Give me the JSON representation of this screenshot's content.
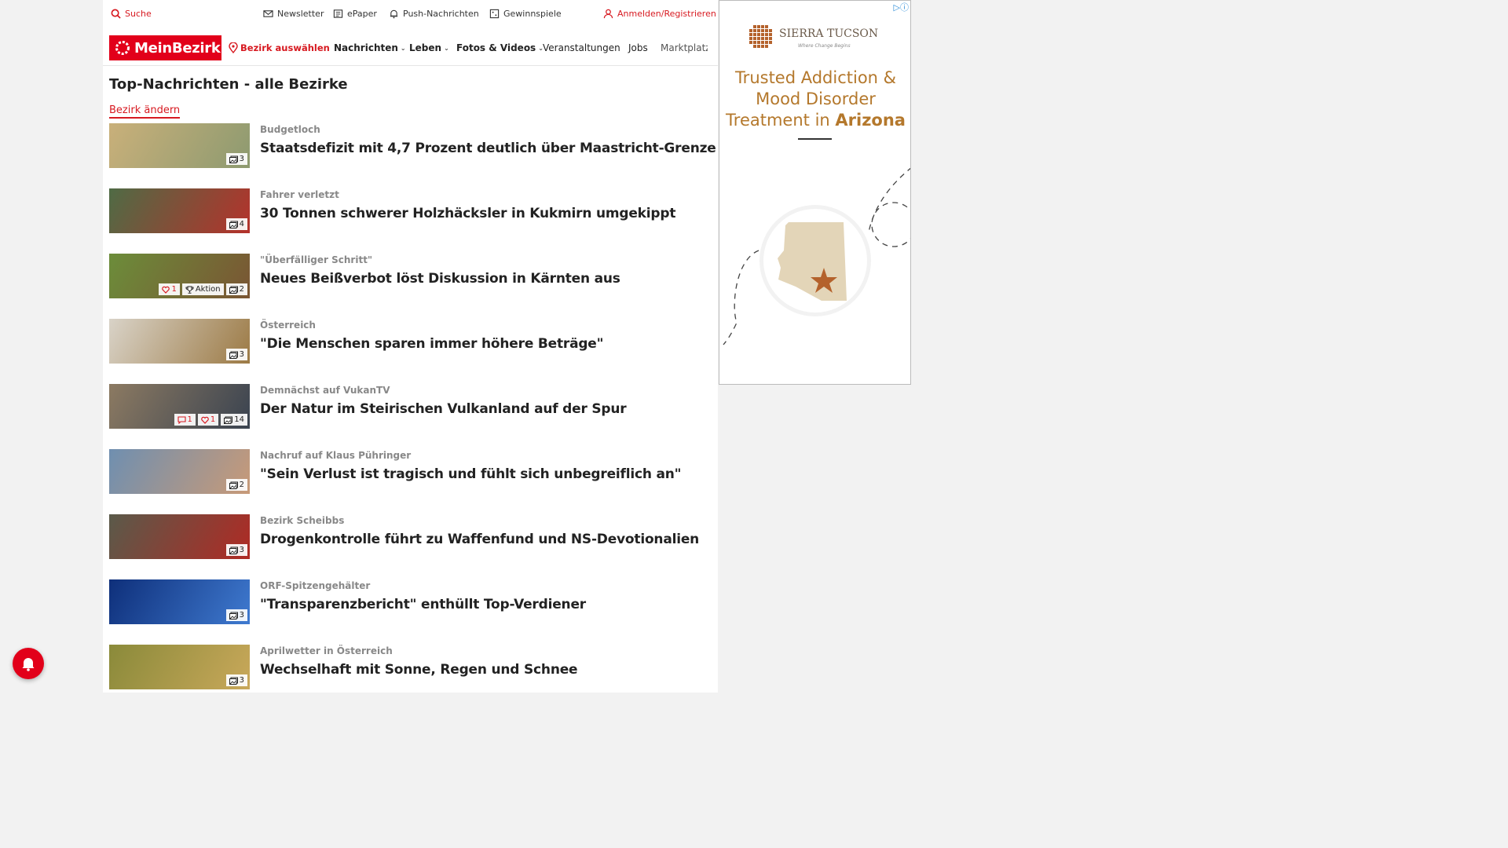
{
  "utility_bar": {
    "search": "Suche",
    "newsletter": "Newsletter",
    "epaper": "ePaper",
    "push": "Push-Nachrichten",
    "gewinnspiele": "Gewinnspiele",
    "login": "Anmelden/Registrieren"
  },
  "nav": {
    "logo": "MeinBezirk",
    "bezirk_select": "Bezirk auswählen",
    "items": [
      "Nachrichten",
      "Leben",
      "Fotos & Videos",
      "Veranstaltungen",
      "Jobs",
      "Marktplatz"
    ]
  },
  "section": {
    "title": "Top-Nachrichten - alle Bezirke",
    "change_link": "Bezirk ändern"
  },
  "articles": [
    {
      "kicker": "Budgetloch",
      "headline": "Staatsdefizit mit 4,7 Prozent deutlich über Maastricht-Grenze",
      "photos": "3",
      "comments": "",
      "likes": "",
      "aktion": "",
      "thumb_colors": [
        "#c9b07a",
        "#8d9a70"
      ]
    },
    {
      "kicker": "Fahrer verletzt",
      "headline": "30 Tonnen schwerer Holzhäcksler in Kukmirn umgekippt",
      "photos": "4",
      "comments": "",
      "likes": "",
      "aktion": "",
      "thumb_colors": [
        "#4f6b45",
        "#b5322b"
      ]
    },
    {
      "kicker": "\"Überfälliger Schritt\"",
      "headline": "Neues Beißverbot löst Diskussion in Kärnten aus",
      "photos": "2",
      "comments": "",
      "likes": "1",
      "aktion": "Aktion",
      "thumb_colors": [
        "#6c8d3a",
        "#7a5533"
      ]
    },
    {
      "kicker": "Österreich",
      "headline": "\"Die Menschen sparen immer höhere Beträge\"",
      "photos": "3",
      "comments": "",
      "likes": "",
      "aktion": "",
      "thumb_colors": [
        "#d9d3c8",
        "#9c7a45"
      ]
    },
    {
      "kicker": "Demnächst auf VukanTV",
      "headline": "Der Natur im Steirischen Vulkanland auf der Spur",
      "photos": "14",
      "comments": "1",
      "likes": "1",
      "aktion": "",
      "thumb_colors": [
        "#8c7a62",
        "#3a4350"
      ]
    },
    {
      "kicker": "Nachruf auf Klaus Pühringer",
      "headline": "\"Sein Verlust ist tragisch und fühlt sich unbegreiflich an\"",
      "photos": "2",
      "comments": "",
      "likes": "",
      "aktion": "",
      "thumb_colors": [
        "#6f8fb0",
        "#c89a78"
      ]
    },
    {
      "kicker": "Bezirk Scheibbs",
      "headline": "Drogenkontrolle führt zu Waffenfund und NS-Devotionalien",
      "photos": "3",
      "comments": "",
      "likes": "",
      "aktion": "",
      "thumb_colors": [
        "#5a5a4a",
        "#b02a24"
      ]
    },
    {
      "kicker": "ORF-Spitzengehälter",
      "headline": "\"Transparenzbericht\" enthüllt Top-Verdiener",
      "photos": "3",
      "comments": "",
      "likes": "",
      "aktion": "",
      "thumb_colors": [
        "#0e2f7a",
        "#3f7ad0"
      ]
    },
    {
      "kicker": "Aprilwetter in Österreich",
      "headline": "Wechselhaft mit Sonne, Regen und Schnee",
      "photos": "3",
      "comments": "",
      "likes": "",
      "aktion": "",
      "thumb_colors": [
        "#8a8a3a",
        "#c9a85a"
      ]
    }
  ],
  "ad": {
    "brand": "SIERRA TUCSON",
    "tagline": "Where Change Begins",
    "headline_line1": "Trusted Addiction &",
    "headline_line2": "Mood Disorder",
    "headline_line3_prefix": "Treatment in ",
    "headline_line3_bold": "Arizona"
  },
  "colors": {
    "brand_red": "#e2001a",
    "ad_gold": "#b4782c"
  }
}
